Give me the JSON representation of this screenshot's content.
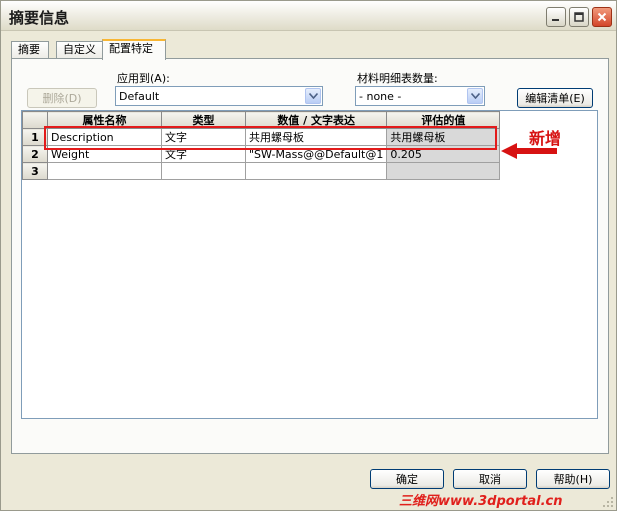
{
  "window": {
    "title": "摘要信息"
  },
  "tabs": [
    {
      "label": "摘要",
      "active": false
    },
    {
      "label": "自定义",
      "active": false
    },
    {
      "label": "配置特定",
      "active": true
    }
  ],
  "toolbar": {
    "delete_label": "删除(D)",
    "apply_to_label": "应用到(A):",
    "apply_to_value": "Default",
    "bom_qty_label": "材料明细表数量:",
    "bom_qty_value": "- none -",
    "edit_list_label": "编辑清单(E)"
  },
  "table": {
    "columns": [
      "属性名称",
      "类型",
      "数值 / 文字表达",
      "评估的值"
    ],
    "rows": [
      {
        "num": "1",
        "name": "Description",
        "type": "文字",
        "value": "共用螺母板",
        "evaluated": "共用螺母板"
      },
      {
        "num": "2",
        "name": "Weight",
        "type": "文字",
        "value": "\"SW-Mass@@Default@1",
        "evaluated": "0.205"
      },
      {
        "num": "3",
        "name": "",
        "type": "",
        "value": "",
        "evaluated": ""
      }
    ]
  },
  "annotation": {
    "label": "新增",
    "color": "#d71212"
  },
  "footer": {
    "ok_label": "确定",
    "cancel_label": "取消",
    "help_label": "帮助(H)"
  },
  "watermark": {
    "text": "三维网www.3dportal.cn"
  },
  "icons": {
    "minimize": "minimize-icon",
    "maximize": "maximize-icon",
    "close": "close-icon",
    "dropdown": "chevron-down-icon",
    "arrow": "red-arrow-icon"
  }
}
